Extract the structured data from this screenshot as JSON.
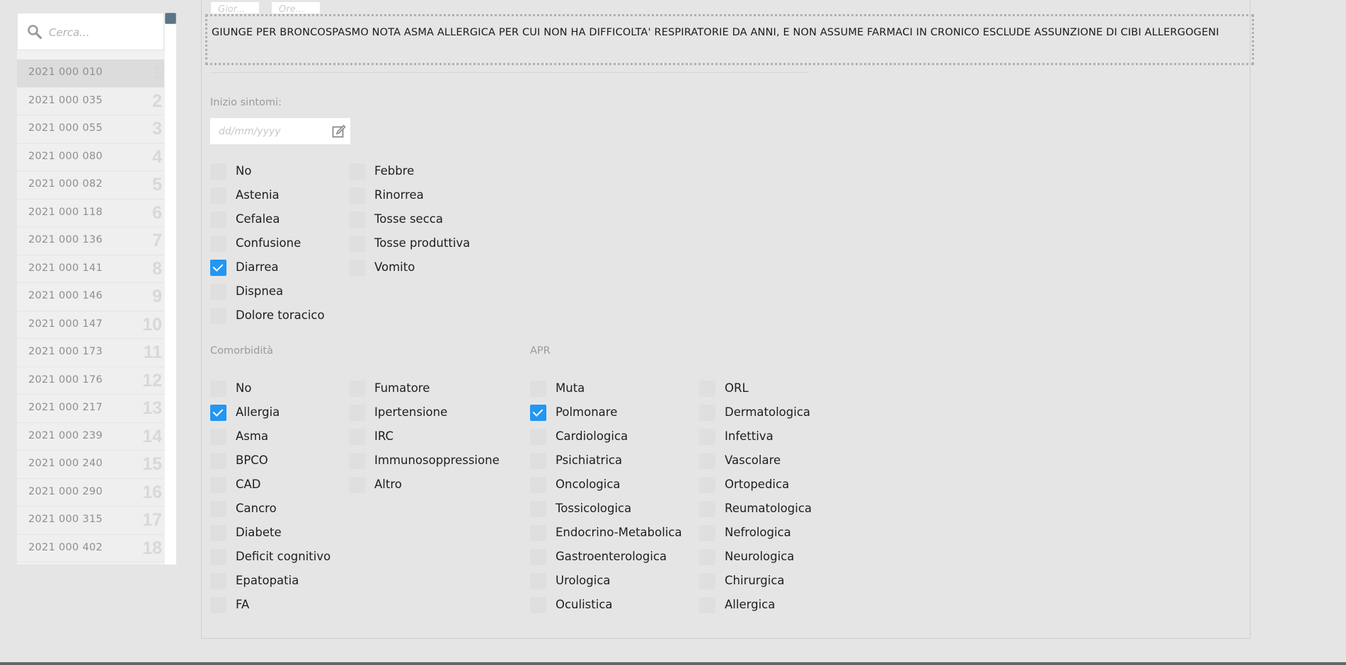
{
  "search": {
    "placeholder": "Cerca..."
  },
  "patients": [
    {
      "id": "2021 000 010",
      "num": "1"
    },
    {
      "id": "2021 000 035",
      "num": "2"
    },
    {
      "id": "2021 000 055",
      "num": "3"
    },
    {
      "id": "2021 000 080",
      "num": "4"
    },
    {
      "id": "2021 000 082",
      "num": "5"
    },
    {
      "id": "2021 000 118",
      "num": "6"
    },
    {
      "id": "2021 000 136",
      "num": "7"
    },
    {
      "id": "2021 000 141",
      "num": "8"
    },
    {
      "id": "2021 000 146",
      "num": "9"
    },
    {
      "id": "2021 000 147",
      "num": "10"
    },
    {
      "id": "2021 000 173",
      "num": "11"
    },
    {
      "id": "2021 000 176",
      "num": "12"
    },
    {
      "id": "2021 000 217",
      "num": "13"
    },
    {
      "id": "2021 000 239",
      "num": "14"
    },
    {
      "id": "2021 000 240",
      "num": "15"
    },
    {
      "id": "2021 000 290",
      "num": "16"
    },
    {
      "id": "2021 000 315",
      "num": "17"
    },
    {
      "id": "2021 000 402",
      "num": "18"
    }
  ],
  "top_fields": {
    "day_placeholder": "Gior...",
    "time_placeholder": "Ore..."
  },
  "notes": "GIUNGE PER BRONCOSPASMO NOTA ASMA ALLERGICA PER CUI NON HA DIFFICOLTA' RESPIRATORIE DA ANNI, E NON ASSUME FARMACI IN CRONICO ESCLUDE ASSUNZIONE DI CIBI ALLERGOGENI",
  "symptom_onset": {
    "label": "Inizio sintomi:",
    "placeholder": "dd/mm/yyyy"
  },
  "symptoms": {
    "col1": [
      {
        "label": "No",
        "checked": false
      },
      {
        "label": "Astenia",
        "checked": false
      },
      {
        "label": "Cefalea",
        "checked": false
      },
      {
        "label": "Confusione",
        "checked": false
      },
      {
        "label": "Diarrea",
        "checked": true
      },
      {
        "label": "Dispnea",
        "checked": false
      },
      {
        "label": "Dolore toracico",
        "checked": false
      }
    ],
    "col2": [
      {
        "label": "Febbre",
        "checked": false
      },
      {
        "label": "Rinorrea",
        "checked": false
      },
      {
        "label": "Tosse secca",
        "checked": false
      },
      {
        "label": "Tosse produttiva",
        "checked": false
      },
      {
        "label": "Vomito",
        "checked": false
      }
    ]
  },
  "comorbidita": {
    "label": "Comorbidità",
    "col1": [
      {
        "label": "No",
        "checked": false
      },
      {
        "label": "Allergia",
        "checked": true
      },
      {
        "label": "Asma",
        "checked": false
      },
      {
        "label": "BPCO",
        "checked": false
      },
      {
        "label": "CAD",
        "checked": false
      },
      {
        "label": "Cancro",
        "checked": false
      },
      {
        "label": "Diabete",
        "checked": false
      },
      {
        "label": "Deficit cognitivo",
        "checked": false
      },
      {
        "label": "Epatopatia",
        "checked": false
      },
      {
        "label": "FA",
        "checked": false
      }
    ],
    "col2": [
      {
        "label": "Fumatore",
        "checked": false
      },
      {
        "label": "Ipertensione",
        "checked": false
      },
      {
        "label": "IRC",
        "checked": false
      },
      {
        "label": "Immunosoppressione",
        "checked": false
      },
      {
        "label": "Altro",
        "checked": false
      }
    ]
  },
  "apr": {
    "label": "APR",
    "col1": [
      {
        "label": "Muta",
        "checked": false
      },
      {
        "label": "Polmonare",
        "checked": true
      },
      {
        "label": "Cardiologica",
        "checked": false
      },
      {
        "label": "Psichiatrica",
        "checked": false
      },
      {
        "label": "Oncologica",
        "checked": false
      },
      {
        "label": "Tossicologica",
        "checked": false
      },
      {
        "label": "Endocrino-Metabolica",
        "checked": false
      },
      {
        "label": "Gastroenterologica",
        "checked": false
      },
      {
        "label": "Urologica",
        "checked": false
      },
      {
        "label": "Oculistica",
        "checked": false
      }
    ],
    "col2": [
      {
        "label": "ORL",
        "checked": false
      },
      {
        "label": "Dermatologica",
        "checked": false
      },
      {
        "label": "Infettiva",
        "checked": false
      },
      {
        "label": "Vascolare",
        "checked": false
      },
      {
        "label": "Ortopedica",
        "checked": false
      },
      {
        "label": "Reumatologica",
        "checked": false
      },
      {
        "label": "Nefrologica",
        "checked": false
      },
      {
        "label": "Neurologica",
        "checked": false
      },
      {
        "label": "Chirurgica",
        "checked": false
      },
      {
        "label": "Allergica",
        "checked": false
      }
    ]
  },
  "colors": {
    "accent": "#2196f3",
    "background": "#e5e5e5"
  },
  "icons": {
    "search": "search-icon",
    "calendar": "edit-calendar-icon"
  }
}
